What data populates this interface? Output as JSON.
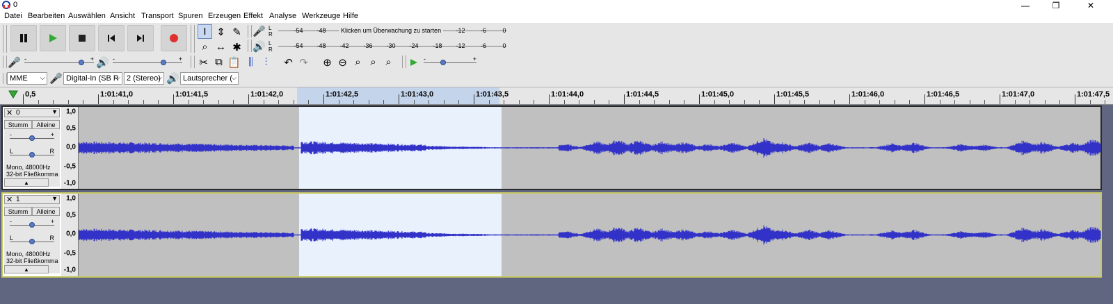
{
  "window": {
    "title": "0",
    "minimize": "—",
    "maximize": "❐",
    "close": "✕"
  },
  "menu": [
    "Datei",
    "Bearbeiten",
    "Auswählen",
    "Ansicht",
    "Transport",
    "Spuren",
    "Erzeugen",
    "Effekt",
    "Analyse",
    "Werkzeuge",
    "Hilfe"
  ],
  "meters": {
    "record": {
      "lr": "L\nR",
      "ticks": [
        "-54",
        "-48",
        "-12",
        "-6",
        "0"
      ],
      "message": "Klicken um Überwachung zu starten"
    },
    "playback": {
      "lr": "L\nR",
      "ticks": [
        "-54",
        "-48",
        "-42",
        "-36",
        "-30",
        "-24",
        "-18",
        "-12",
        "-6",
        "0"
      ]
    }
  },
  "mixer": {
    "rec_min": "-",
    "rec_max": "+",
    "play_min": "-",
    "play_max": "+",
    "rec_level": 0.85,
    "play_level": 0.75
  },
  "playat": {
    "min": "-",
    "max": "+",
    "level": 0.35
  },
  "device": {
    "host": "MME",
    "input": "Digital-In (SB R",
    "channels": "2 (Stereo)",
    "output": "Lautsprecher ("
  },
  "ruler": {
    "labels": [
      "0,5",
      "1:01:41,0",
      "1:01:41,5",
      "1:01:42,0",
      "1:01:42,5",
      "1:01:43,0",
      "1:01:43,5",
      "1:01:44,0",
      "1:01:44,5",
      "1:01:45,0",
      "1:01:45,5",
      "1:01:46,0",
      "1:01:46,5",
      "1:01:47,0",
      "1:01:47,5"
    ]
  },
  "tracks": [
    {
      "name": "0",
      "mute": "Stumm",
      "solo": "Alleine",
      "gain_min": "-",
      "gain_max": "+",
      "pan_l": "L",
      "pan_r": "R",
      "info1": "Mono, 48000Hz",
      "info2": "32-bit Fließkomma",
      "gain": 0.5,
      "pan": 0.5
    },
    {
      "name": "1",
      "mute": "Stumm",
      "solo": "Alleine",
      "gain_min": "-",
      "gain_max": "+",
      "pan_l": "L",
      "pan_r": "R",
      "info1": "Mono, 48000Hz",
      "info2": "32-bit Fließkomma",
      "gain": 0.5,
      "pan": 0.5
    }
  ],
  "vscale": [
    "1,0",
    "0,5",
    "0,0",
    "-0,5",
    "-1,0"
  ],
  "colors": {
    "waveform": "#3232c8",
    "selection": "#e9f2fc",
    "background": "#c0c0c0",
    "record": "#e03030",
    "play": "#33aa33"
  }
}
